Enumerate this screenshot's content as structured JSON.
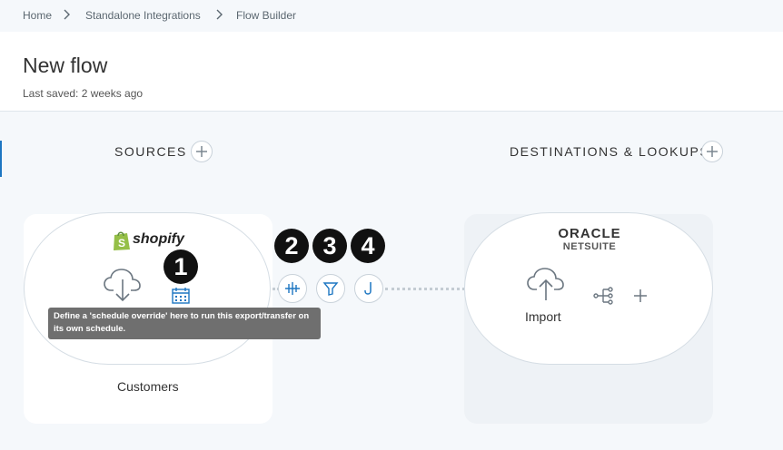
{
  "breadcrumb": {
    "items": [
      {
        "label": "Home"
      },
      {
        "label": "Standalone Integrations"
      },
      {
        "label": "Flow Builder"
      }
    ]
  },
  "flow": {
    "title": "New flow",
    "last_saved": "Last saved: 2 weeks ago"
  },
  "sources": {
    "title": "SOURCES",
    "card": {
      "logo_text": "shopify",
      "name": "Customers",
      "tooltip": "Define a 'schedule override' here to run this export/transfer on its own schedule."
    }
  },
  "destinations": {
    "title": "DESTINATIONS & LOOKUPS",
    "card": {
      "logo_line1": "ORACLE",
      "logo_line2": "NETSUITE",
      "action_label": "Import"
    }
  },
  "step_badges": [
    "1",
    "2",
    "3",
    "4"
  ],
  "icons": {
    "export": "cloud-download-icon",
    "schedule": "calendar-icon",
    "transform": "transform-icon",
    "filter": "filter-icon",
    "hook": "hook-icon",
    "import": "cloud-upload-icon",
    "mapping": "mapping-icon",
    "add": "plus-icon"
  },
  "colors": {
    "accent": "#1d76c2",
    "panel_bg": "#f5f8fb",
    "badge_bg": "#111111",
    "tooltip_bg": "#6f6f6f",
    "shopify_green": "#95bf47"
  }
}
